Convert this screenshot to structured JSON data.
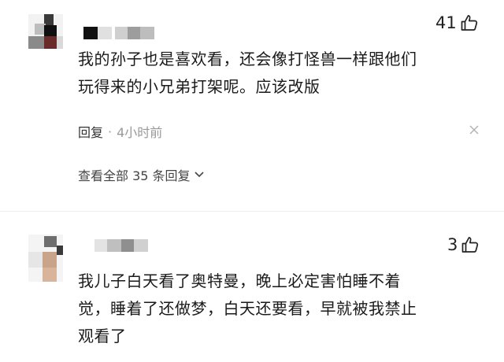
{
  "comments": [
    {
      "text_lines": [
        "我的孙子也是喜欢看，还会像打怪兽一样跟他们",
        "玩得来的小兄弟打架呢。应该改版"
      ],
      "likes": "41",
      "reply_label": "回复",
      "separator": "·",
      "time": "4小时前",
      "view_replies": "查看全部 35 条回复"
    },
    {
      "text_lines": [
        "我儿子白天看了奥特曼，晚上必定害怕睡不着",
        "觉，睡着了还做梦，白天还要看，早就被我禁止",
        "观看了"
      ],
      "likes": "3"
    }
  ],
  "icons": {
    "like": "thumbs-up-icon",
    "more": "more-options-icon",
    "chevron": "chevron-down-icon"
  },
  "colors": {
    "text": "#1a1a1a",
    "meta": "#999999",
    "link": "#333333"
  }
}
